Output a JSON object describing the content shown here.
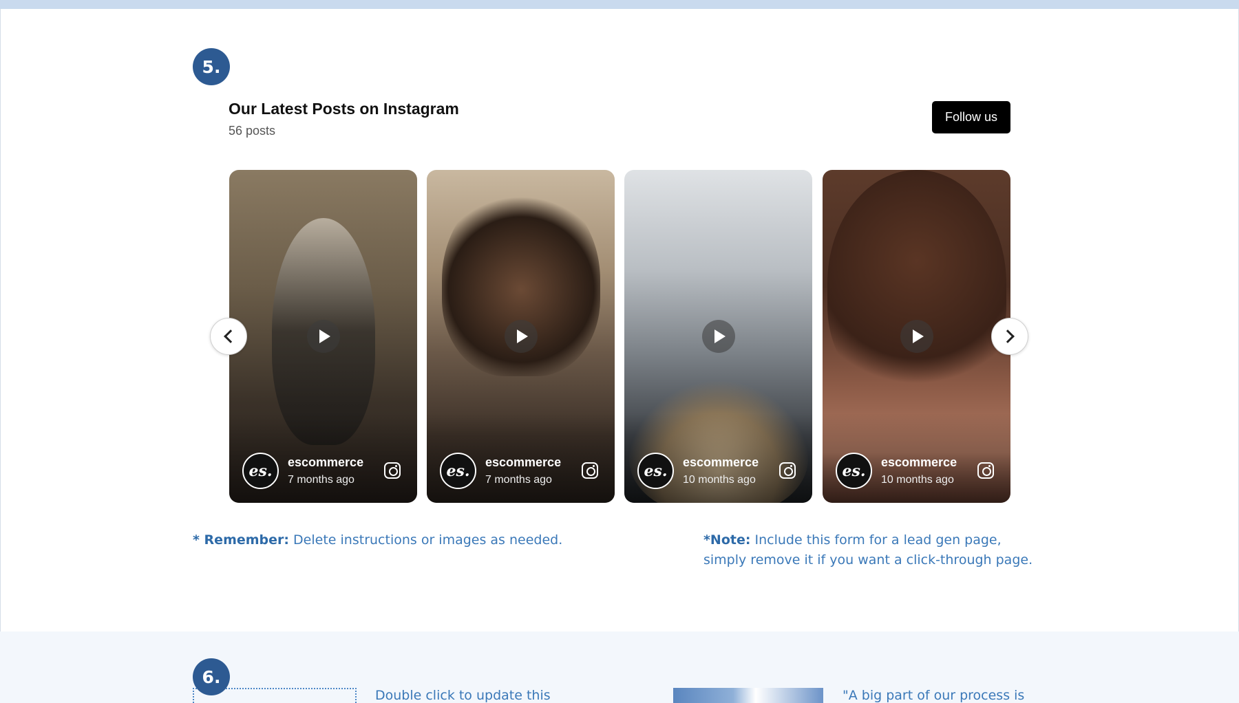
{
  "section5": {
    "step": "5.",
    "title": "Our Latest Posts on Instagram",
    "post_count": "56 posts",
    "follow_label": "Follow us",
    "posts": [
      {
        "user": "escommerce",
        "time": "7 months ago",
        "avatar": "es."
      },
      {
        "user": "escommerce",
        "time": "7 months ago",
        "avatar": "es."
      },
      {
        "user": "escommerce",
        "time": "10 months ago",
        "avatar": "es."
      },
      {
        "user": "escommerce",
        "time": "10 months ago",
        "avatar": "es."
      }
    ],
    "icons": {
      "play": "play-icon",
      "social": "instagram-icon",
      "prev": "chevron-left-icon",
      "next": "chevron-right-icon"
    }
  },
  "notes": {
    "remember_label": "* Remember:",
    "remember_text": " Delete instructions or images as needed.",
    "note_label": "*Note:",
    "note_text": " Include this form for a lead gen page, simply remove it if you want a click-through page."
  },
  "section6": {
    "step": "6.",
    "text_a": "Double click to update this",
    "text_b": "\"A big part of our process is"
  },
  "colors": {
    "accent": "#2d5a92",
    "note_text": "#3a78b8",
    "button": "#000000"
  }
}
